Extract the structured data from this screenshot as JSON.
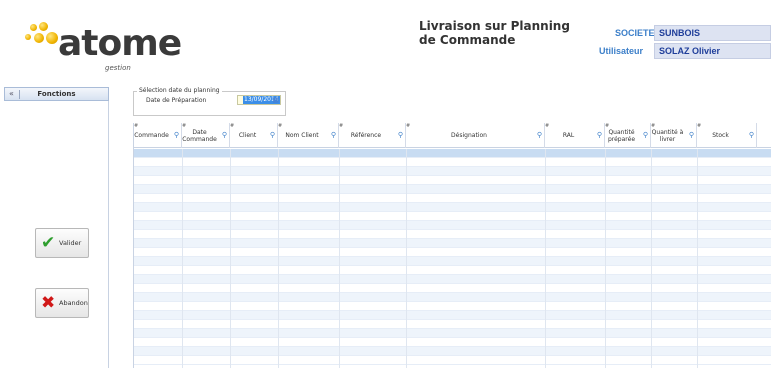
{
  "logo": {
    "word": "atome",
    "sub": "gestion"
  },
  "title": "Livraison sur Planning de Commande",
  "societe": {
    "label": "SOCIETE",
    "value": "SUNBOIS"
  },
  "utilisateur": {
    "label": "Utilisateur",
    "value": "SOLAZ Olivier"
  },
  "sidebar": {
    "header": "Fonctions",
    "chevron": "«"
  },
  "buttons": {
    "valider": {
      "label": "Valider",
      "icon": "check-icon",
      "color": "#2e9e2e"
    },
    "abandon": {
      "label": "Abandon",
      "icon": "cross-icon",
      "color": "#d01818"
    }
  },
  "selection": {
    "legend": "Sélection date du planning",
    "label": "Date de Préparation",
    "date": "13/09/2014"
  },
  "grid": {
    "columns": [
      {
        "label": "Commande"
      },
      {
        "label": "Date Commande"
      },
      {
        "label": "Client"
      },
      {
        "label": "Nom Client"
      },
      {
        "label": "Référence"
      },
      {
        "label": "Désignation"
      },
      {
        "label": "RAL"
      },
      {
        "label": "Quantité préparée"
      },
      {
        "label": "Quantité à livrer"
      },
      {
        "label": "Stock"
      }
    ]
  },
  "colors": {
    "accent": "#3c7fc9",
    "selected_row": "#c8dcf2",
    "alt_row": "#eef4fb"
  }
}
